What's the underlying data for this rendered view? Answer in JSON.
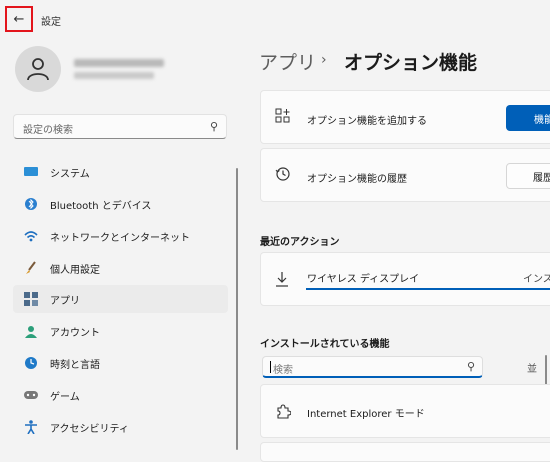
{
  "window": {
    "title": "設定"
  },
  "search": {
    "placeholder": "設定の検索"
  },
  "nav": {
    "items": [
      {
        "label": "システム",
        "icon": "monitor-icon"
      },
      {
        "label": "Bluetooth とデバイス",
        "icon": "bluetooth-icon"
      },
      {
        "label": "ネットワークとインターネット",
        "icon": "wifi-icon"
      },
      {
        "label": "個人用設定",
        "icon": "brush-icon"
      },
      {
        "label": "アプリ",
        "icon": "apps-icon",
        "selected": true
      },
      {
        "label": "アカウント",
        "icon": "person-icon"
      },
      {
        "label": "時刻と言語",
        "icon": "globe-clock-icon"
      },
      {
        "label": "ゲーム",
        "icon": "gamepad-icon"
      },
      {
        "label": "アクセシビリティ",
        "icon": "accessibility-icon"
      }
    ]
  },
  "breadcrumb": {
    "parent": "アプリ",
    "separator": "›",
    "current": "オプション機能"
  },
  "cards": {
    "add": {
      "label": "オプション機能を追加する",
      "button": "機能"
    },
    "history": {
      "label": "オプション機能の履歴",
      "button": "履歴"
    }
  },
  "recent": {
    "title": "最近のアクション",
    "item": {
      "label": "ワイヤレス ディスプレイ",
      "status": "インス",
      "progress": 1.0
    }
  },
  "installed": {
    "title": "インストールされている機能",
    "search_placeholder": "検索",
    "sort_label": "並",
    "items": [
      {
        "label": "Internet Explorer モード"
      }
    ]
  },
  "colors": {
    "accent": "#005fb8",
    "highlight": "#e3141b"
  }
}
